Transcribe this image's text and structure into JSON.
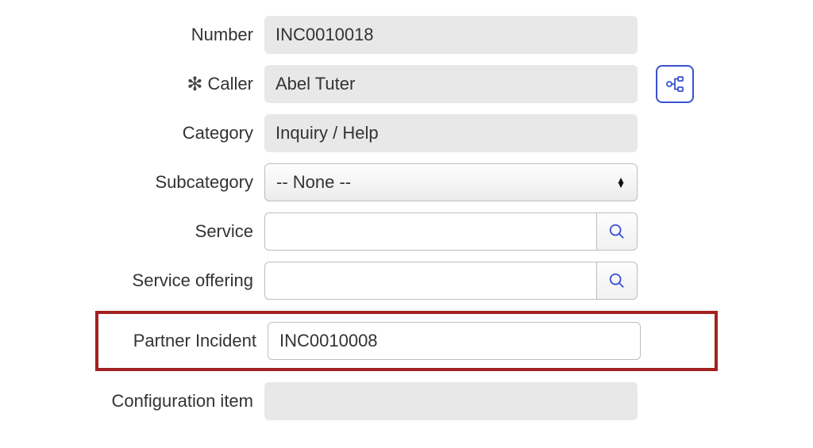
{
  "colors": {
    "accent": "#3a51d0",
    "highlight": "#a32121"
  },
  "fields": {
    "number": {
      "label": "Number",
      "value": "INC0010018"
    },
    "caller": {
      "label": "Caller",
      "value": "Abel Tuter",
      "required": true
    },
    "category": {
      "label": "Category",
      "value": "Inquiry / Help"
    },
    "subcategory": {
      "label": "Subcategory",
      "value": "-- None --"
    },
    "service": {
      "label": "Service",
      "value": ""
    },
    "service_offering": {
      "label": "Service offering",
      "value": ""
    },
    "partner_incident": {
      "label": "Partner Incident",
      "value": "INC0010008"
    },
    "configuration_item": {
      "label": "Configuration item",
      "value": ""
    }
  }
}
